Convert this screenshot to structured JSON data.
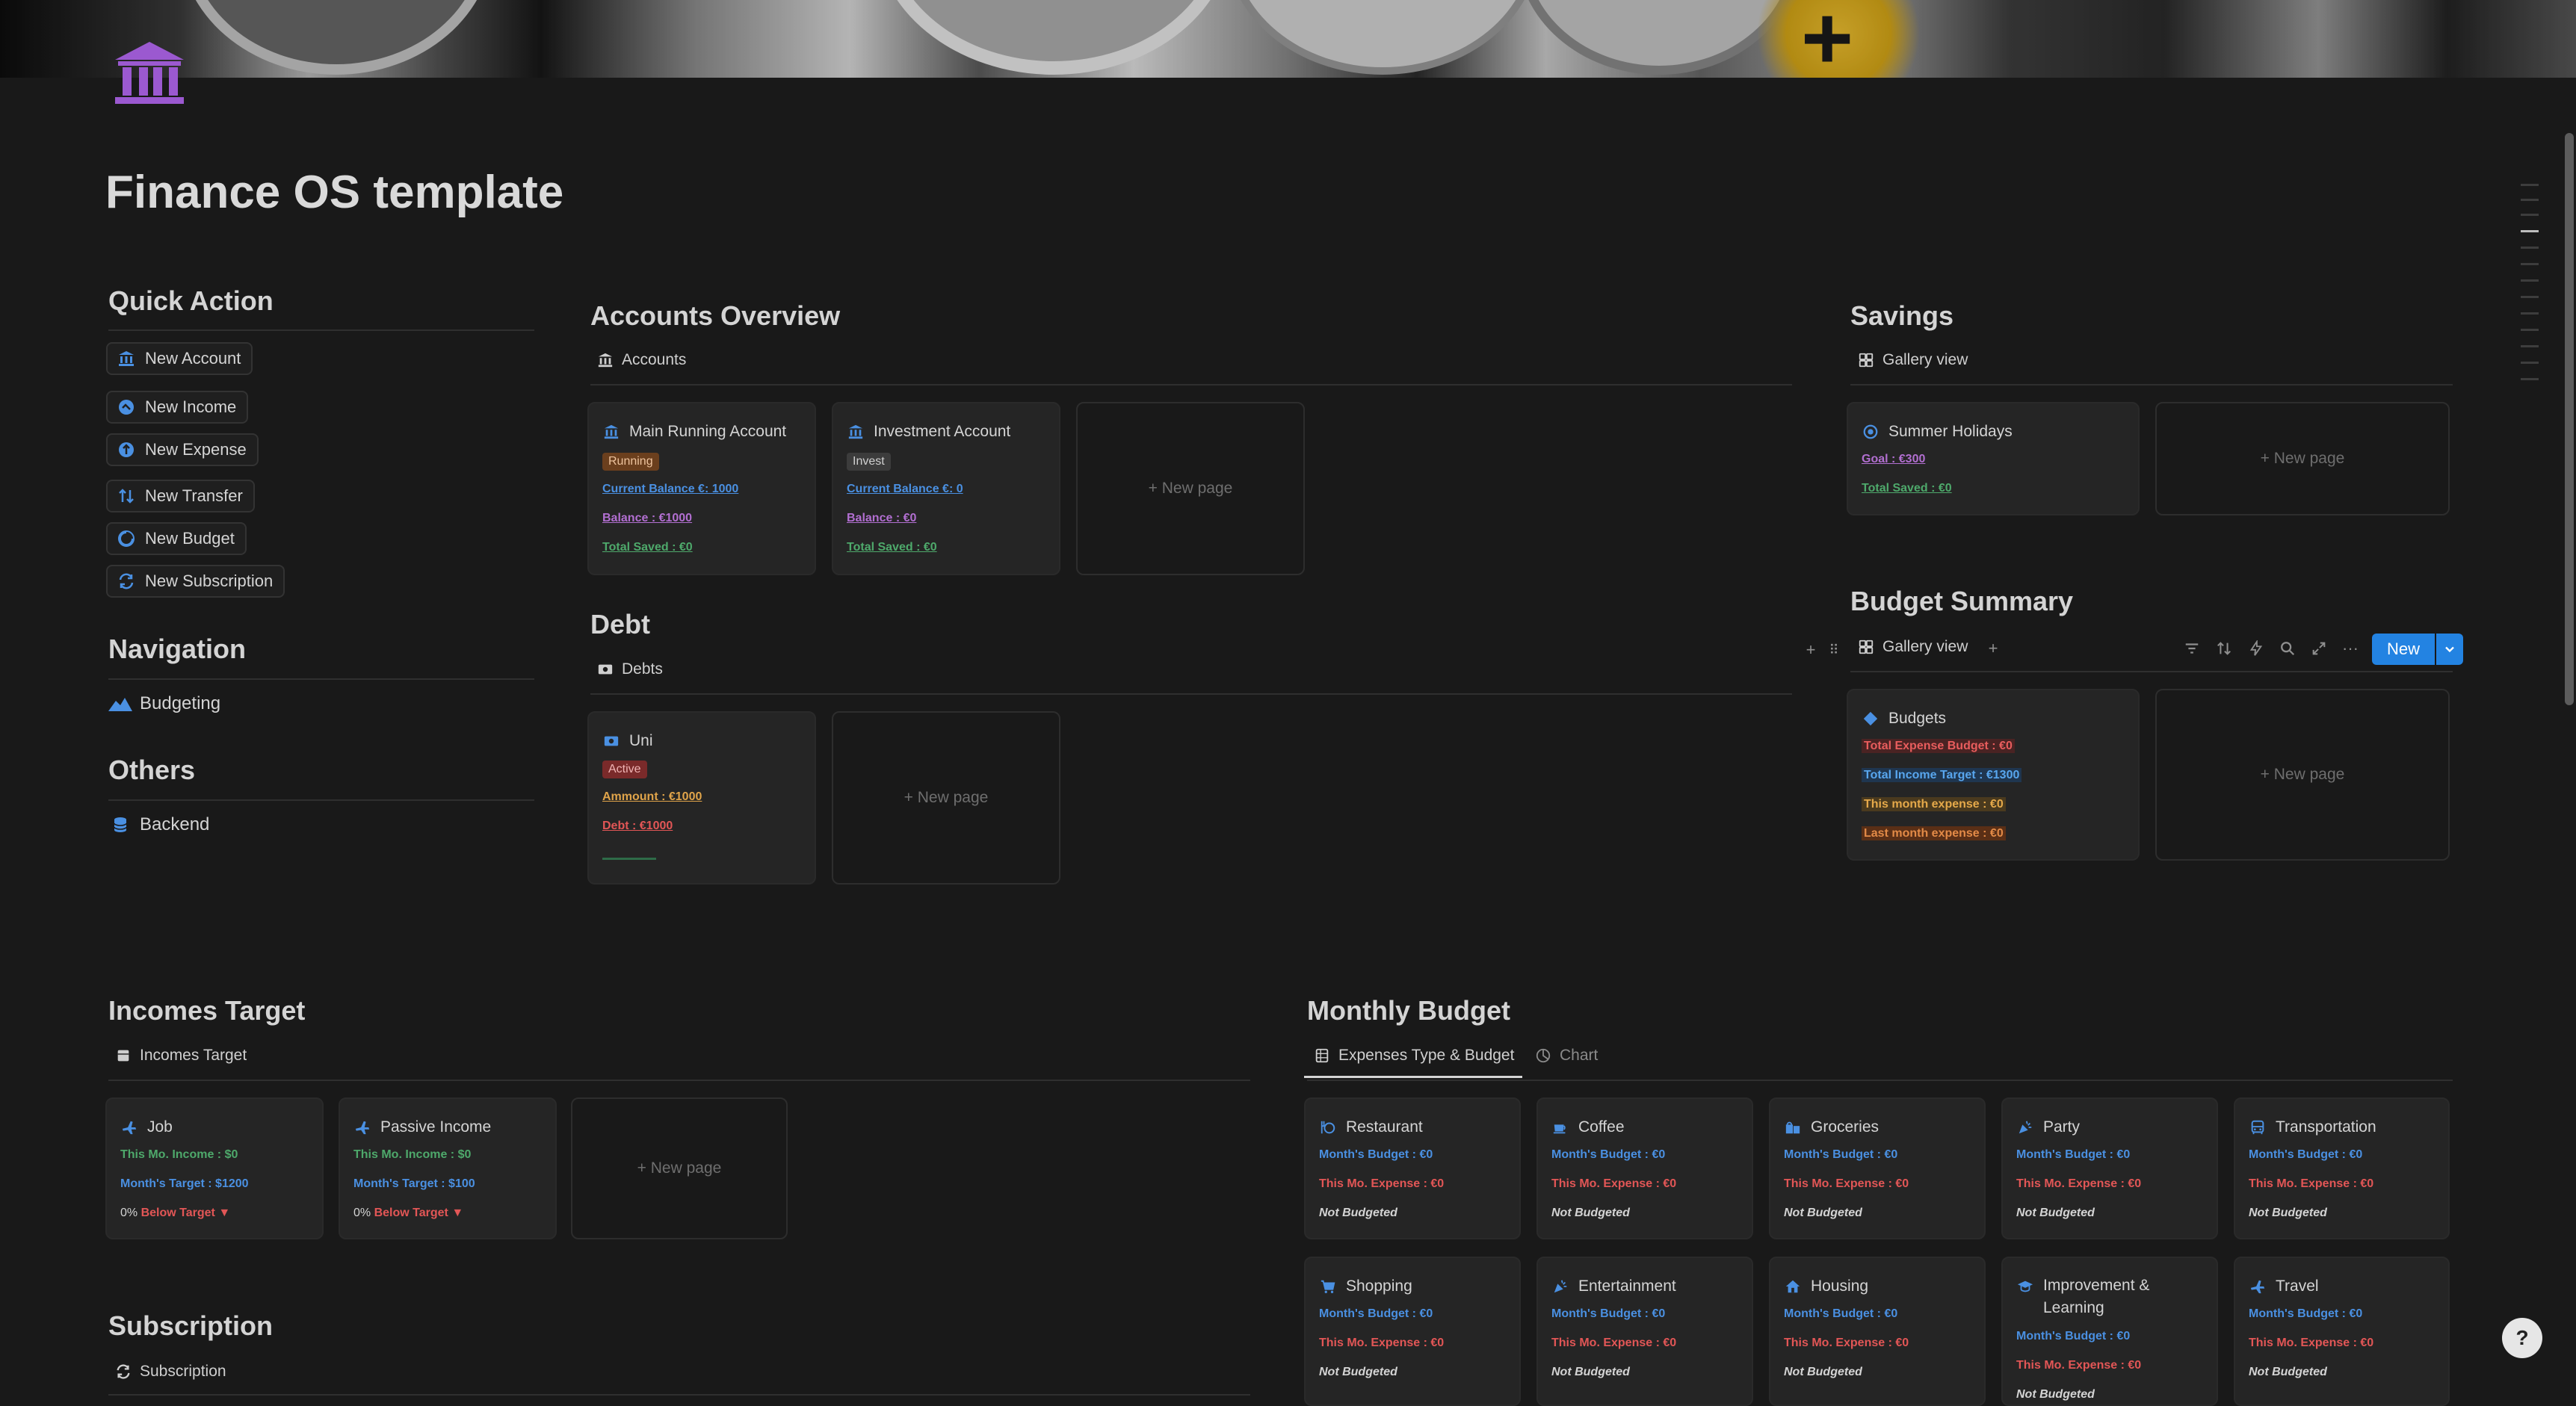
{
  "page": {
    "title": "Finance OS template"
  },
  "quick_action": {
    "heading": "Quick Action",
    "buttons": [
      {
        "label": "New Account",
        "icon": "bank-icon"
      },
      {
        "label": "New Income",
        "icon": "income-icon"
      },
      {
        "label": "New Expense",
        "icon": "expense-icon"
      },
      {
        "label": "New Transfer",
        "icon": "transfer-icon"
      },
      {
        "label": "New Budget",
        "icon": "budget-icon"
      },
      {
        "label": "New Subscription",
        "icon": "subscription-icon"
      }
    ]
  },
  "navigation": {
    "heading": "Navigation",
    "items": [
      {
        "label": "Budgeting",
        "icon": "mountain-icon"
      }
    ]
  },
  "others": {
    "heading": "Others",
    "items": [
      {
        "label": "Backend",
        "icon": "database-icon"
      }
    ]
  },
  "accounts": {
    "heading": "Accounts Overview",
    "view": "Accounts",
    "cards": [
      {
        "title": "Main Running Account",
        "tag": "Running",
        "current_balance": "Current Balance €: 1000",
        "balance": "Balance : €1000",
        "total_saved": "Total Saved : €0"
      },
      {
        "title": "Investment Account",
        "tag": "Invest",
        "current_balance": "Current Balance €: 0",
        "balance": "Balance : €0",
        "total_saved": "Total Saved : €0"
      }
    ],
    "new_page": "+ New page"
  },
  "debt": {
    "heading": "Debt",
    "view": "Debts",
    "cards": [
      {
        "title": "Uni",
        "tag": "Active",
        "amount": "Ammount : €1000",
        "debt": "Debt : €1000"
      }
    ],
    "new_page": "+ New page"
  },
  "savings": {
    "heading": "Savings",
    "view": "Gallery view",
    "cards": [
      {
        "title": "Summer Holidays",
        "goal": "Goal : €300",
        "total_saved": "Total Saved : €0"
      }
    ],
    "new_page": "+ New page"
  },
  "budget_summary": {
    "heading": "Budget Summary",
    "view": "Gallery view",
    "new_button": "New",
    "cards": [
      {
        "title": "Budgets",
        "total_expense_budget": "Total Expense Budget : €0",
        "total_income_target": "Total Income Target : €1300",
        "this_month_expense": "This month expense : €0",
        "last_month_expense": "Last month expense : €0"
      }
    ],
    "new_page": "+ New page"
  },
  "incomes_target": {
    "heading": "Incomes Target",
    "view": "Incomes Target",
    "cards": [
      {
        "title": "Job",
        "this_mo_income": "This Mo. Income : $0",
        "month_target": "Month's Target : $1200",
        "percent": "0%",
        "status": "Below Target"
      },
      {
        "title": "Passive Income",
        "this_mo_income": "This Mo. Income : $0",
        "month_target": "Month's Target : $100",
        "percent": "0%",
        "status": "Below Target"
      }
    ],
    "new_page": "+ New page"
  },
  "subscription": {
    "heading": "Subscription",
    "view": "Subscription"
  },
  "monthly_budget": {
    "heading": "Monthly Budget",
    "tabs": [
      {
        "label": "Expenses Type & Budget"
      },
      {
        "label": "Chart"
      }
    ],
    "cards": [
      {
        "title": "Restaurant",
        "budget": "Month's Budget : €0",
        "expense": "This Mo. Expense : €0",
        "status": "Not Budgeted"
      },
      {
        "title": "Coffee",
        "budget": "Month's Budget : €0",
        "expense": "This Mo. Expense : €0",
        "status": "Not Budgeted"
      },
      {
        "title": "Groceries",
        "budget": "Month's Budget : €0",
        "expense": "This Mo. Expense : €0",
        "status": "Not Budgeted"
      },
      {
        "title": "Party",
        "budget": "Month's Budget : €0",
        "expense": "This Mo. Expense : €0",
        "status": "Not Budgeted"
      },
      {
        "title": "Transportation",
        "budget": "Month's Budget : €0",
        "expense": "This Mo. Expense : €0",
        "status": "Not Budgeted"
      },
      {
        "title": "Shopping",
        "budget": "Month's Budget : €0",
        "expense": "This Mo. Expense : €0",
        "status": "Not Budgeted"
      },
      {
        "title": "Entertainment",
        "budget": "Month's Budget : €0",
        "expense": "This Mo. Expense : €0",
        "status": "Not Budgeted"
      },
      {
        "title": "Housing",
        "budget": "Month's Budget : €0",
        "expense": "This Mo. Expense : €0",
        "status": "Not Budgeted"
      },
      {
        "title_line1": "Improvement &",
        "title_line2": "Learning",
        "budget": "Month's Budget : €0",
        "expense": "This Mo. Expense : €0",
        "status": "Not Budgeted"
      },
      {
        "title": "Travel",
        "budget": "Month's Budget : €0",
        "expense": "This Mo. Expense : €0",
        "status": "Not Budgeted"
      }
    ]
  },
  "colors": {
    "accent": "#2383e2",
    "background": "#191919",
    "card": "#252525",
    "icon": "#4a90e2",
    "page_icon": "#9b59d0"
  }
}
